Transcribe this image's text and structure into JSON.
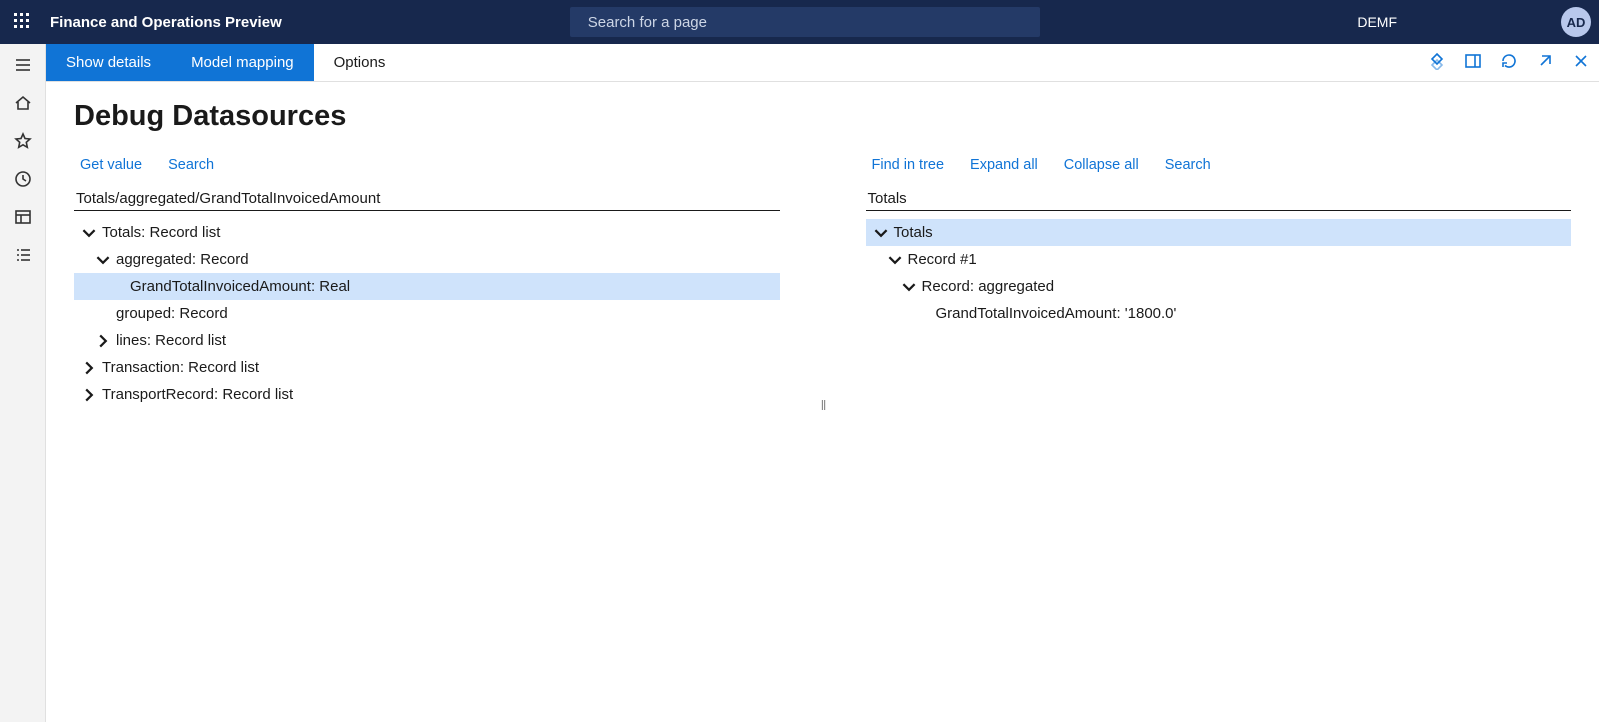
{
  "topbar": {
    "brand": "Finance and Operations Preview",
    "search_placeholder": "Search for a page",
    "company": "DEMF",
    "avatar_initials": "AD"
  },
  "cmdbar": {
    "show_details": "Show details",
    "model_mapping": "Model mapping",
    "options": "Options"
  },
  "page": {
    "title": "Debug Datasources",
    "left_toolbar": {
      "get_value": "Get value",
      "search": "Search"
    },
    "right_toolbar": {
      "find_in_tree": "Find in tree",
      "expand_all": "Expand all",
      "collapse_all": "Collapse all",
      "search": "Search"
    },
    "left_path": "Totals/aggregated/GrandTotalInvoicedAmount",
    "right_path": "Totals",
    "left_tree": [
      {
        "depth": 0,
        "label": "Totals: Record list",
        "state": "open"
      },
      {
        "depth": 1,
        "label": "aggregated: Record",
        "state": "open"
      },
      {
        "depth": 2,
        "label": "GrandTotalInvoicedAmount: Real",
        "state": "leaf",
        "selected": true
      },
      {
        "depth": 1,
        "label": "grouped: Record",
        "state": "leaf"
      },
      {
        "depth": 1,
        "label": "lines: Record list",
        "state": "closed"
      },
      {
        "depth": 0,
        "label": "Transaction: Record list",
        "state": "closed"
      },
      {
        "depth": 0,
        "label": "TransportRecord: Record list",
        "state": "closed"
      }
    ],
    "right_tree": [
      {
        "depth": 0,
        "label": "Totals",
        "state": "open",
        "selected": true
      },
      {
        "depth": 1,
        "label": "Record #1",
        "state": "open"
      },
      {
        "depth": 2,
        "label": "Record: aggregated",
        "state": "open"
      },
      {
        "depth": 3,
        "label": "GrandTotalInvoicedAmount: '1800.0'",
        "state": "leaf"
      }
    ]
  }
}
